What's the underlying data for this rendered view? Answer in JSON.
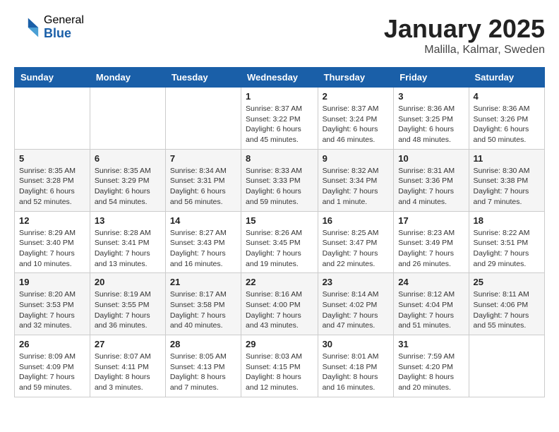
{
  "header": {
    "logo_general": "General",
    "logo_blue": "Blue",
    "month_title": "January 2025",
    "location": "Malilla, Kalmar, Sweden"
  },
  "weekdays": [
    "Sunday",
    "Monday",
    "Tuesday",
    "Wednesday",
    "Thursday",
    "Friday",
    "Saturday"
  ],
  "weeks": [
    [
      {
        "day": "",
        "info": ""
      },
      {
        "day": "",
        "info": ""
      },
      {
        "day": "",
        "info": ""
      },
      {
        "day": "1",
        "info": "Sunrise: 8:37 AM\nSunset: 3:22 PM\nDaylight: 6 hours\nand 45 minutes."
      },
      {
        "day": "2",
        "info": "Sunrise: 8:37 AM\nSunset: 3:24 PM\nDaylight: 6 hours\nand 46 minutes."
      },
      {
        "day": "3",
        "info": "Sunrise: 8:36 AM\nSunset: 3:25 PM\nDaylight: 6 hours\nand 48 minutes."
      },
      {
        "day": "4",
        "info": "Sunrise: 8:36 AM\nSunset: 3:26 PM\nDaylight: 6 hours\nand 50 minutes."
      }
    ],
    [
      {
        "day": "5",
        "info": "Sunrise: 8:35 AM\nSunset: 3:28 PM\nDaylight: 6 hours\nand 52 minutes."
      },
      {
        "day": "6",
        "info": "Sunrise: 8:35 AM\nSunset: 3:29 PM\nDaylight: 6 hours\nand 54 minutes."
      },
      {
        "day": "7",
        "info": "Sunrise: 8:34 AM\nSunset: 3:31 PM\nDaylight: 6 hours\nand 56 minutes."
      },
      {
        "day": "8",
        "info": "Sunrise: 8:33 AM\nSunset: 3:33 PM\nDaylight: 6 hours\nand 59 minutes."
      },
      {
        "day": "9",
        "info": "Sunrise: 8:32 AM\nSunset: 3:34 PM\nDaylight: 7 hours\nand 1 minute."
      },
      {
        "day": "10",
        "info": "Sunrise: 8:31 AM\nSunset: 3:36 PM\nDaylight: 7 hours\nand 4 minutes."
      },
      {
        "day": "11",
        "info": "Sunrise: 8:30 AM\nSunset: 3:38 PM\nDaylight: 7 hours\nand 7 minutes."
      }
    ],
    [
      {
        "day": "12",
        "info": "Sunrise: 8:29 AM\nSunset: 3:40 PM\nDaylight: 7 hours\nand 10 minutes."
      },
      {
        "day": "13",
        "info": "Sunrise: 8:28 AM\nSunset: 3:41 PM\nDaylight: 7 hours\nand 13 minutes."
      },
      {
        "day": "14",
        "info": "Sunrise: 8:27 AM\nSunset: 3:43 PM\nDaylight: 7 hours\nand 16 minutes."
      },
      {
        "day": "15",
        "info": "Sunrise: 8:26 AM\nSunset: 3:45 PM\nDaylight: 7 hours\nand 19 minutes."
      },
      {
        "day": "16",
        "info": "Sunrise: 8:25 AM\nSunset: 3:47 PM\nDaylight: 7 hours\nand 22 minutes."
      },
      {
        "day": "17",
        "info": "Sunrise: 8:23 AM\nSunset: 3:49 PM\nDaylight: 7 hours\nand 26 minutes."
      },
      {
        "day": "18",
        "info": "Sunrise: 8:22 AM\nSunset: 3:51 PM\nDaylight: 7 hours\nand 29 minutes."
      }
    ],
    [
      {
        "day": "19",
        "info": "Sunrise: 8:20 AM\nSunset: 3:53 PM\nDaylight: 7 hours\nand 32 minutes."
      },
      {
        "day": "20",
        "info": "Sunrise: 8:19 AM\nSunset: 3:55 PM\nDaylight: 7 hours\nand 36 minutes."
      },
      {
        "day": "21",
        "info": "Sunrise: 8:17 AM\nSunset: 3:58 PM\nDaylight: 7 hours\nand 40 minutes."
      },
      {
        "day": "22",
        "info": "Sunrise: 8:16 AM\nSunset: 4:00 PM\nDaylight: 7 hours\nand 43 minutes."
      },
      {
        "day": "23",
        "info": "Sunrise: 8:14 AM\nSunset: 4:02 PM\nDaylight: 7 hours\nand 47 minutes."
      },
      {
        "day": "24",
        "info": "Sunrise: 8:12 AM\nSunset: 4:04 PM\nDaylight: 7 hours\nand 51 minutes."
      },
      {
        "day": "25",
        "info": "Sunrise: 8:11 AM\nSunset: 4:06 PM\nDaylight: 7 hours\nand 55 minutes."
      }
    ],
    [
      {
        "day": "26",
        "info": "Sunrise: 8:09 AM\nSunset: 4:09 PM\nDaylight: 7 hours\nand 59 minutes."
      },
      {
        "day": "27",
        "info": "Sunrise: 8:07 AM\nSunset: 4:11 PM\nDaylight: 8 hours\nand 3 minutes."
      },
      {
        "day": "28",
        "info": "Sunrise: 8:05 AM\nSunset: 4:13 PM\nDaylight: 8 hours\nand 7 minutes."
      },
      {
        "day": "29",
        "info": "Sunrise: 8:03 AM\nSunset: 4:15 PM\nDaylight: 8 hours\nand 12 minutes."
      },
      {
        "day": "30",
        "info": "Sunrise: 8:01 AM\nSunset: 4:18 PM\nDaylight: 8 hours\nand 16 minutes."
      },
      {
        "day": "31",
        "info": "Sunrise: 7:59 AM\nSunset: 4:20 PM\nDaylight: 8 hours\nand 20 minutes."
      },
      {
        "day": "",
        "info": ""
      }
    ]
  ]
}
